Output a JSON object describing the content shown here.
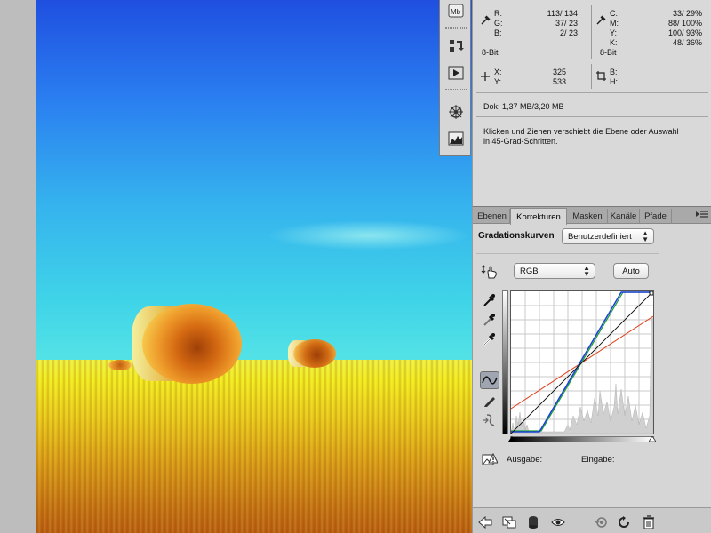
{
  "info": {
    "rgb_labels": [
      "R:",
      "G:",
      "B:"
    ],
    "rgb_values": [
      "113/ 134",
      "37/  23",
      "2/  23"
    ],
    "cmyk_labels": [
      "C:",
      "M:",
      "Y:",
      "K:"
    ],
    "cmyk_values": [
      "33/  29%",
      "88/ 100%",
      "100/  93%",
      "48/  36%"
    ],
    "bitdepth_left": "8-Bit",
    "bitdepth_right": "8-Bit",
    "xy_labels": [
      "X:",
      "Y:"
    ],
    "xy_values": [
      "325",
      "533"
    ],
    "bh_labels": [
      "B:",
      "H:"
    ],
    "doc_size": "Dok: 1,37 MB/3,20 MB",
    "hint": "Klicken und Ziehen verschiebt die Ebene oder Auswahl",
    "hint2": "in 45-Grad-Schritten."
  },
  "tabs": [
    "Ebenen",
    "Korrekturen",
    "Masken",
    "Kanäle",
    "Pfade"
  ],
  "active_tab": "Korrekturen",
  "adjust": {
    "title": "Gradationskurven",
    "preset": "Benutzerdefiniert",
    "channel": "RGB",
    "auto_label": "Auto",
    "output_label": "Ausgabe:",
    "input_label": "Eingabe:"
  },
  "strip_icons": [
    "mb-icon",
    "pan-icon",
    "play-icon",
    "navigator-icon",
    "histogram-icon"
  ],
  "colors": {
    "accent": "#1f4fe0",
    "panel": "#d6d6d6",
    "curve_red": "#e0401a",
    "curve_blue": "#1b3fd8",
    "curve_green": "#1aa030"
  }
}
